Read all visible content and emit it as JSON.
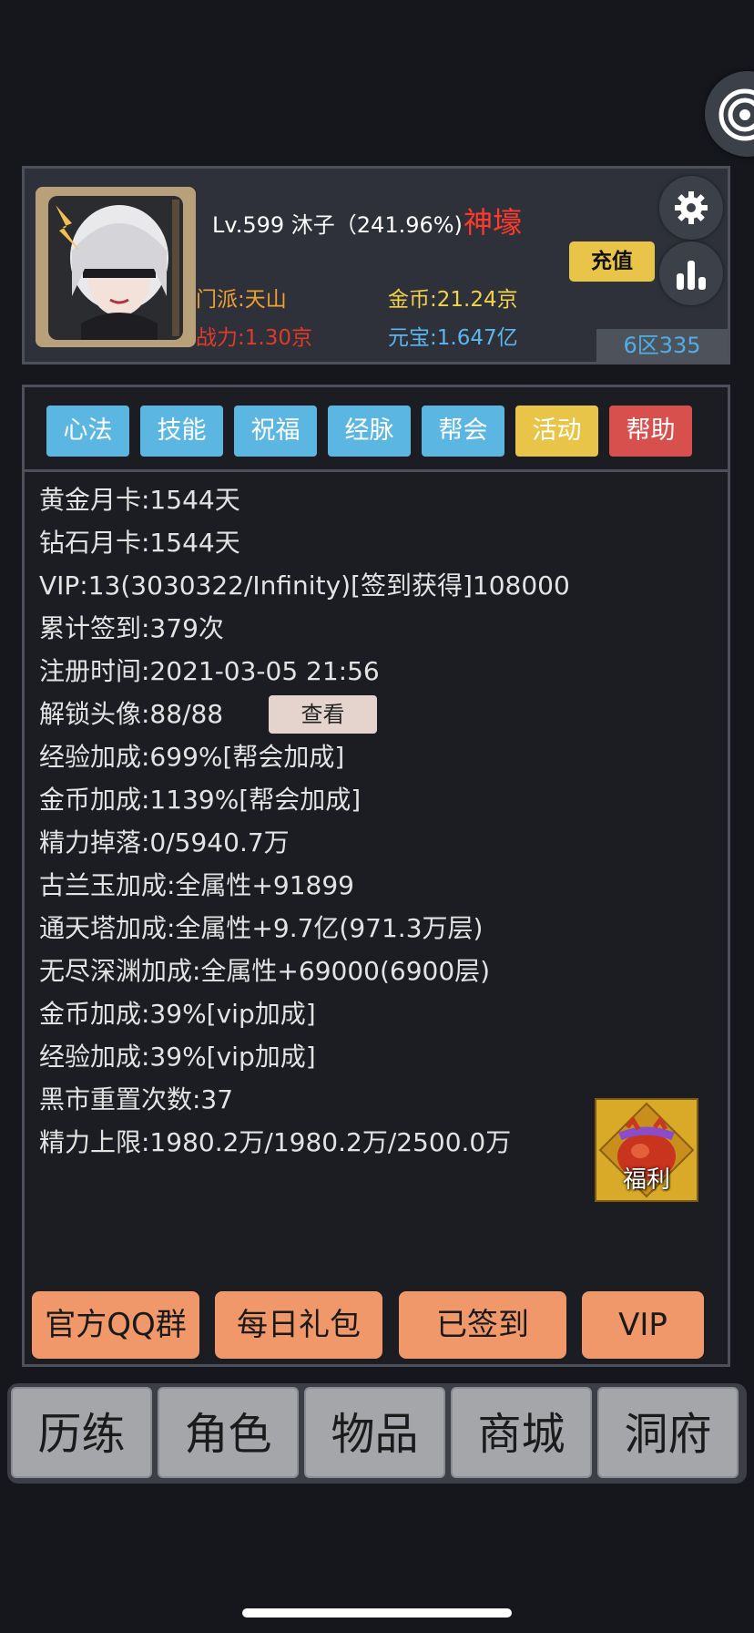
{
  "profile": {
    "level_name": "Lv.599 沐子（241.96%)",
    "title": "神壕",
    "sect": "门派:天山",
    "power": "战力:1.30京",
    "gold": "金币:21.24京",
    "ingot": "元宝:1.647亿",
    "recharge_label": "充值",
    "server": "6区335"
  },
  "tabs": [
    "心法",
    "技能",
    "祝福",
    "经脉",
    "帮会",
    "活动",
    "帮助"
  ],
  "info": [
    "黄金月卡:1544天",
    "钻石月卡:1544天",
    "VIP:13(3030322/Infinity)[签到获得]108000",
    "累计签到:379次",
    "注册时间:2021-03-05 21:56",
    "解锁头像:88/88",
    "经验加成:699%[帮会加成]",
    "金币加成:1139%[帮会加成]",
    "精力掉落:0/5940.7万",
    "古兰玉加成:全属性+91899",
    "通天塔加成:全属性+9.7亿(971.3万层)",
    "无尽深渊加成:全属性+69000(6900层)",
    "金币加成:39%[vip加成]",
    "经验加成:39%[vip加成]",
    "黑市重置次数:37",
    "精力上限:1980.2万/1980.2万/2500.0万"
  ],
  "view_button": "查看",
  "welfare_label": "福利",
  "actions": [
    "官方QQ群",
    "每日礼包",
    "已签到",
    "VIP"
  ],
  "nav": [
    "历练",
    "角色",
    "物品",
    "商城",
    "洞府"
  ],
  "colors": {
    "tab_blue": "#5cb6e2",
    "tab_yellow": "#e8c448",
    "tab_red": "#d8504e",
    "action_orange": "#f0986a",
    "title_red": "#ff3a2a"
  },
  "icons": [
    "swirl-icon",
    "gear-icon",
    "bar-chart-icon",
    "gift-bag-icon"
  ]
}
